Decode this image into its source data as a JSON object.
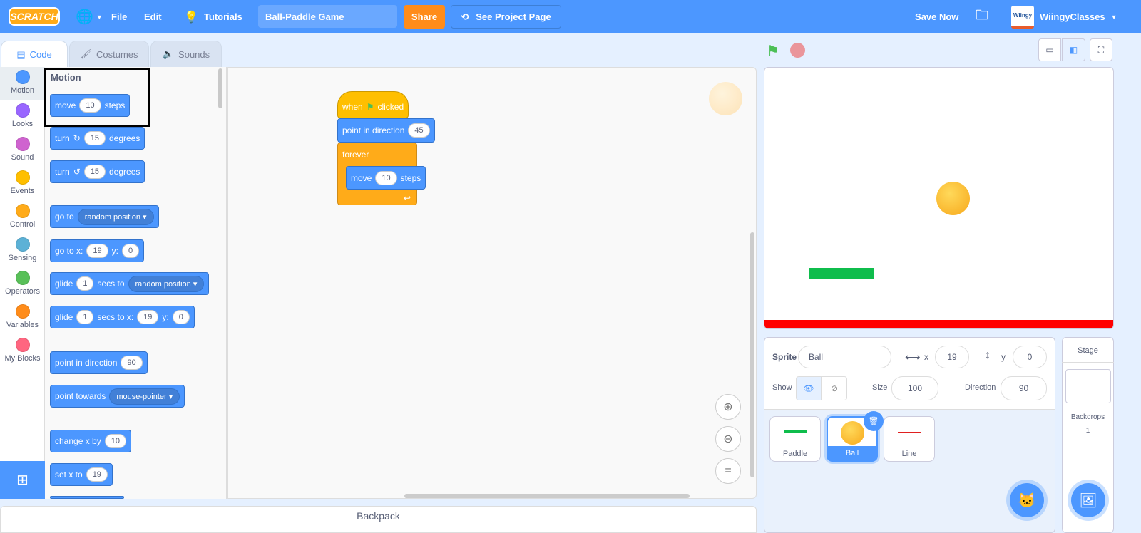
{
  "menubar": {
    "logo": "SCRATCH",
    "file": "File",
    "edit": "Edit",
    "tutorials": "Tutorials",
    "project_title": "Ball-Paddle Game",
    "share": "Share",
    "see_project": "See Project Page",
    "save_now": "Save Now",
    "username": "WiingyClasses",
    "avatar_text": "Wiingy"
  },
  "tabs": [
    {
      "label": "Code",
      "active": true
    },
    {
      "label": "Costumes"
    },
    {
      "label": "Sounds"
    }
  ],
  "categories": [
    {
      "label": "Motion",
      "color": "#4c97ff"
    },
    {
      "label": "Looks",
      "color": "#9966ff"
    },
    {
      "label": "Sound",
      "color": "#cf63cf"
    },
    {
      "label": "Events",
      "color": "#ffbf00"
    },
    {
      "label": "Control",
      "color": "#ffab19"
    },
    {
      "label": "Sensing",
      "color": "#5cb1d6"
    },
    {
      "label": "Operators",
      "color": "#59c059"
    },
    {
      "label": "Variables",
      "color": "#ff8c1a"
    },
    {
      "label": "My Blocks",
      "color": "#ff6680"
    }
  ],
  "palette": {
    "heading": "Motion",
    "move": {
      "a": "move",
      "v": "10",
      "b": "steps"
    },
    "turn_right": {
      "a": "turn",
      "v": "15",
      "b": "degrees"
    },
    "turn_left": {
      "a": "turn",
      "v": "15",
      "b": "degrees"
    },
    "goto": {
      "a": "go to",
      "d": "random position"
    },
    "gotoxy": {
      "a": "go to x:",
      "x": "19",
      "b": "y:",
      "y": "0"
    },
    "glide": {
      "a": "glide",
      "v": "1",
      "b": "secs to",
      "d": "random position"
    },
    "glidexy": {
      "a": "glide",
      "v": "1",
      "b": "secs to x:",
      "x": "19",
      "c": "y:",
      "y": "0"
    },
    "point": {
      "a": "point in direction",
      "v": "90"
    },
    "towards": {
      "a": "point towards",
      "d": "mouse-pointer"
    },
    "changex": {
      "a": "change x by",
      "v": "10"
    },
    "setx": {
      "a": "set x to",
      "v": "19"
    }
  },
  "script": {
    "when": "when",
    "clicked": "clicked",
    "point": "point in direction",
    "point_v": "45",
    "forever": "forever",
    "move": "move",
    "move_v": "10",
    "steps": "steps"
  },
  "backpack": "Backpack",
  "sprite_info": {
    "sprite_label": "Sprite",
    "sprite_name": "Ball",
    "x_label": "x",
    "x": "19",
    "y_label": "y",
    "y": "0",
    "show_label": "Show",
    "size_label": "Size",
    "size": "100",
    "direction_label": "Direction",
    "direction": "90"
  },
  "sprites": [
    {
      "name": "Paddle"
    },
    {
      "name": "Ball",
      "selected": true
    },
    {
      "name": "Line"
    }
  ],
  "stage_panel": {
    "title": "Stage",
    "backdrops_label": "Backdrops",
    "backdrops": "1"
  }
}
